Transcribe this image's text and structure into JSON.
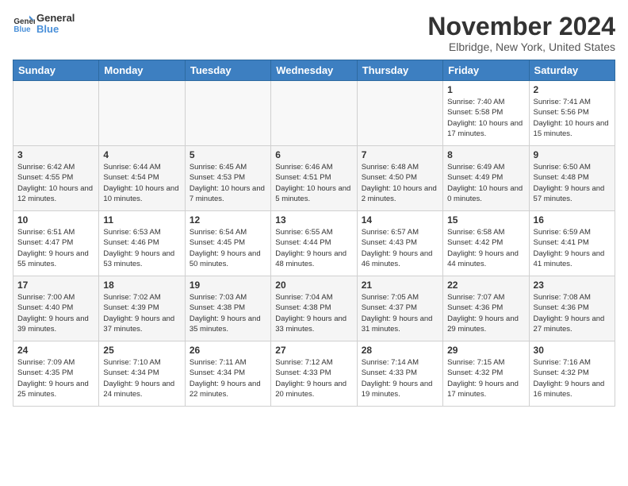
{
  "logo": {
    "text_general": "General",
    "text_blue": "Blue"
  },
  "header": {
    "title": "November 2024",
    "location": "Elbridge, New York, United States"
  },
  "days_of_week": [
    "Sunday",
    "Monday",
    "Tuesday",
    "Wednesday",
    "Thursday",
    "Friday",
    "Saturday"
  ],
  "weeks": [
    [
      {
        "day": "",
        "info": ""
      },
      {
        "day": "",
        "info": ""
      },
      {
        "day": "",
        "info": ""
      },
      {
        "day": "",
        "info": ""
      },
      {
        "day": "",
        "info": ""
      },
      {
        "day": "1",
        "info": "Sunrise: 7:40 AM\nSunset: 5:58 PM\nDaylight: 10 hours and 17 minutes."
      },
      {
        "day": "2",
        "info": "Sunrise: 7:41 AM\nSunset: 5:56 PM\nDaylight: 10 hours and 15 minutes."
      }
    ],
    [
      {
        "day": "3",
        "info": "Sunrise: 6:42 AM\nSunset: 4:55 PM\nDaylight: 10 hours and 12 minutes."
      },
      {
        "day": "4",
        "info": "Sunrise: 6:44 AM\nSunset: 4:54 PM\nDaylight: 10 hours and 10 minutes."
      },
      {
        "day": "5",
        "info": "Sunrise: 6:45 AM\nSunset: 4:53 PM\nDaylight: 10 hours and 7 minutes."
      },
      {
        "day": "6",
        "info": "Sunrise: 6:46 AM\nSunset: 4:51 PM\nDaylight: 10 hours and 5 minutes."
      },
      {
        "day": "7",
        "info": "Sunrise: 6:48 AM\nSunset: 4:50 PM\nDaylight: 10 hours and 2 minutes."
      },
      {
        "day": "8",
        "info": "Sunrise: 6:49 AM\nSunset: 4:49 PM\nDaylight: 10 hours and 0 minutes."
      },
      {
        "day": "9",
        "info": "Sunrise: 6:50 AM\nSunset: 4:48 PM\nDaylight: 9 hours and 57 minutes."
      }
    ],
    [
      {
        "day": "10",
        "info": "Sunrise: 6:51 AM\nSunset: 4:47 PM\nDaylight: 9 hours and 55 minutes."
      },
      {
        "day": "11",
        "info": "Sunrise: 6:53 AM\nSunset: 4:46 PM\nDaylight: 9 hours and 53 minutes."
      },
      {
        "day": "12",
        "info": "Sunrise: 6:54 AM\nSunset: 4:45 PM\nDaylight: 9 hours and 50 minutes."
      },
      {
        "day": "13",
        "info": "Sunrise: 6:55 AM\nSunset: 4:44 PM\nDaylight: 9 hours and 48 minutes."
      },
      {
        "day": "14",
        "info": "Sunrise: 6:57 AM\nSunset: 4:43 PM\nDaylight: 9 hours and 46 minutes."
      },
      {
        "day": "15",
        "info": "Sunrise: 6:58 AM\nSunset: 4:42 PM\nDaylight: 9 hours and 44 minutes."
      },
      {
        "day": "16",
        "info": "Sunrise: 6:59 AM\nSunset: 4:41 PM\nDaylight: 9 hours and 41 minutes."
      }
    ],
    [
      {
        "day": "17",
        "info": "Sunrise: 7:00 AM\nSunset: 4:40 PM\nDaylight: 9 hours and 39 minutes."
      },
      {
        "day": "18",
        "info": "Sunrise: 7:02 AM\nSunset: 4:39 PM\nDaylight: 9 hours and 37 minutes."
      },
      {
        "day": "19",
        "info": "Sunrise: 7:03 AM\nSunset: 4:38 PM\nDaylight: 9 hours and 35 minutes."
      },
      {
        "day": "20",
        "info": "Sunrise: 7:04 AM\nSunset: 4:38 PM\nDaylight: 9 hours and 33 minutes."
      },
      {
        "day": "21",
        "info": "Sunrise: 7:05 AM\nSunset: 4:37 PM\nDaylight: 9 hours and 31 minutes."
      },
      {
        "day": "22",
        "info": "Sunrise: 7:07 AM\nSunset: 4:36 PM\nDaylight: 9 hours and 29 minutes."
      },
      {
        "day": "23",
        "info": "Sunrise: 7:08 AM\nSunset: 4:36 PM\nDaylight: 9 hours and 27 minutes."
      }
    ],
    [
      {
        "day": "24",
        "info": "Sunrise: 7:09 AM\nSunset: 4:35 PM\nDaylight: 9 hours and 25 minutes."
      },
      {
        "day": "25",
        "info": "Sunrise: 7:10 AM\nSunset: 4:34 PM\nDaylight: 9 hours and 24 minutes."
      },
      {
        "day": "26",
        "info": "Sunrise: 7:11 AM\nSunset: 4:34 PM\nDaylight: 9 hours and 22 minutes."
      },
      {
        "day": "27",
        "info": "Sunrise: 7:12 AM\nSunset: 4:33 PM\nDaylight: 9 hours and 20 minutes."
      },
      {
        "day": "28",
        "info": "Sunrise: 7:14 AM\nSunset: 4:33 PM\nDaylight: 9 hours and 19 minutes."
      },
      {
        "day": "29",
        "info": "Sunrise: 7:15 AM\nSunset: 4:32 PM\nDaylight: 9 hours and 17 minutes."
      },
      {
        "day": "30",
        "info": "Sunrise: 7:16 AM\nSunset: 4:32 PM\nDaylight: 9 hours and 16 minutes."
      }
    ]
  ]
}
